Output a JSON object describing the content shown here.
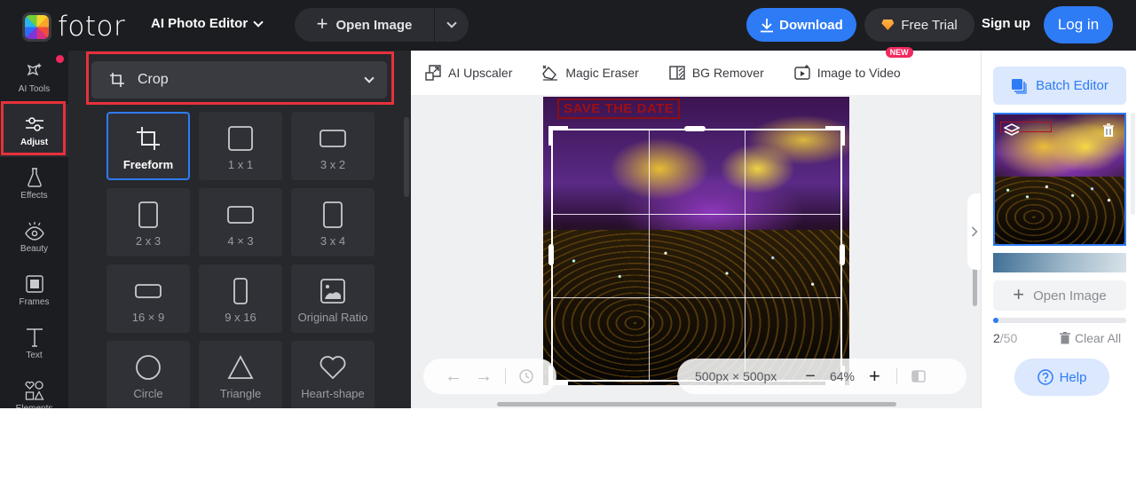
{
  "topbar": {
    "logo_text": "fotor",
    "app_menu_label": "AI Photo Editor",
    "open_image_label": "Open Image",
    "download_label": "Download",
    "free_trial_label": "Free Trial",
    "signup_label": "Sign up",
    "login_label": "Log in"
  },
  "leftnav": {
    "items": [
      {
        "label": "AI Tools",
        "icon": "sparkle-icon",
        "active": false,
        "has_dot": true
      },
      {
        "label": "Adjust",
        "icon": "sliders-icon",
        "active": true
      },
      {
        "label": "Effects",
        "icon": "flask-icon",
        "active": false
      },
      {
        "label": "Beauty",
        "icon": "eye-icon",
        "active": false
      },
      {
        "label": "Frames",
        "icon": "frame-icon",
        "active": false
      },
      {
        "label": "Text",
        "icon": "text-icon",
        "active": false
      },
      {
        "label": "Elements",
        "icon": "shapes-icon",
        "active": false
      }
    ]
  },
  "panel": {
    "section_label": "Crop",
    "crop_options": [
      {
        "label": "Freeform",
        "icon": "crop-icon",
        "selected": true
      },
      {
        "label": "1 x 1",
        "icon": "square-icon"
      },
      {
        "label": "3 x 2",
        "icon": "landscape-rect-icon"
      },
      {
        "label": "2 x 3",
        "icon": "portrait-rect-icon"
      },
      {
        "label": "4 × 3",
        "icon": "landscape-rect-icon"
      },
      {
        "label": "3 x 4",
        "icon": "portrait-rect-icon"
      },
      {
        "label": "16 × 9",
        "icon": "wide-rect-icon"
      },
      {
        "label": "9 x 16",
        "icon": "tall-rect-icon"
      },
      {
        "label": "Original Ratio",
        "icon": "image-icon"
      },
      {
        "label": "Circle",
        "icon": "circle-icon"
      },
      {
        "label": "Triangle",
        "icon": "triangle-icon"
      },
      {
        "label": "Heart-shape",
        "icon": "heart-icon"
      }
    ]
  },
  "quicktools": [
    {
      "label": "AI Upscaler",
      "icon": "upscale-icon"
    },
    {
      "label": "Magic Eraser",
      "icon": "eraser-icon"
    },
    {
      "label": "BG Remover",
      "icon": "bg-remover-icon"
    },
    {
      "label": "Image to Video",
      "icon": "video-icon",
      "badge": "NEW"
    }
  ],
  "canvas": {
    "image_text": "SAVE THE DATE",
    "dimensions": "500px × 500px",
    "zoom": "64%"
  },
  "rightpanel": {
    "batch_editor_label": "Batch Editor",
    "open_image_label": "Open Image",
    "count_current": "2",
    "count_total": "/50",
    "upload_progress": 0.04,
    "clear_all_label": "Clear All",
    "help_label": "Help"
  },
  "colors": {
    "accent": "#2e7bf6",
    "highlight_box": "#e8313b",
    "new_badge": "#f0295e"
  }
}
